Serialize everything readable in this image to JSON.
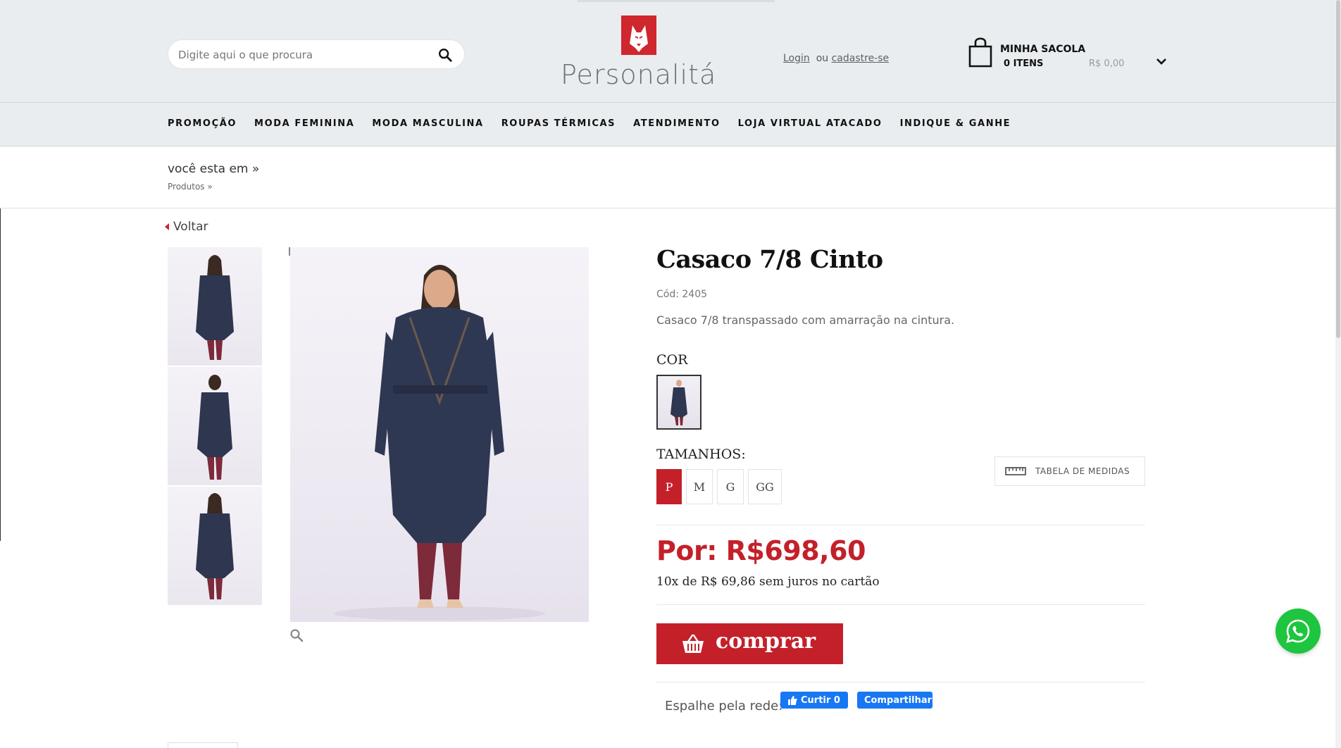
{
  "header": {
    "search_placeholder": "Digite aqui o que procura",
    "logo_text": "Personalitá",
    "login_label": "Login",
    "or_label": "ou",
    "register_label": "cadastre-se",
    "cart_title": "MINHA SACOLA",
    "cart_items": "0 ITENS",
    "cart_total": "R$ 0,00"
  },
  "nav": {
    "items": [
      "PROMOÇÃO",
      "MODA FEMININA",
      "MODA MASCULINA",
      "ROUPAS TÉRMICAS",
      "ATENDIMENTO",
      "LOJA VIRTUAL ATACADO",
      "INDIQUE & GANHE"
    ]
  },
  "breadcrumb": {
    "title": "você esta em »",
    "path": "Produtos  »"
  },
  "back_label": "Voltar",
  "product": {
    "title": "Casaco 7/8 Cinto",
    "code": "Cód: 2405",
    "description": "Casaco 7/8 transpassado com amarração na cintura.",
    "color_label": "COR",
    "sizes_label": "TAMANHOS:",
    "sizes": [
      "P",
      "M",
      "G",
      "GG"
    ],
    "selected_size": "P",
    "size_chart_label": "TABELA DE MEDIDAS",
    "price": "Por: R$698,60",
    "installments": "10x de R$ 69,86 sem juros no cartão",
    "buy_label": "comprar"
  },
  "social": {
    "share_label": "Espalhe pela rede:",
    "like_label": "Curtir 0",
    "share_button": "Compartilhar"
  },
  "colors": {
    "accent": "#c4202a",
    "whatsapp": "#1ec53e",
    "facebook": "#1877f2"
  },
  "icons": [
    "search-icon",
    "bag-icon",
    "chevron-down-icon",
    "ruler-icon",
    "basket-icon",
    "zoom-icon",
    "thumbs-up-icon",
    "whatsapp-icon"
  ]
}
